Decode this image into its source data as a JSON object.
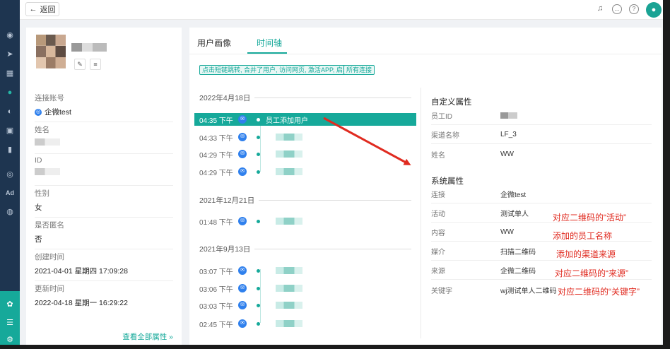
{
  "topbar": {
    "back_label": "返回"
  },
  "profile": {
    "fields": [
      {
        "label": "连接账号",
        "value": "企微test"
      },
      {
        "label": "姓名",
        "value": ""
      },
      {
        "label": "ID",
        "value": ""
      },
      {
        "label": "性别",
        "value": "女"
      },
      {
        "label": "是否匿名",
        "value": "否"
      },
      {
        "label": "创建时间",
        "value": "2021-04-01 星期四 17:09:28"
      },
      {
        "label": "更新时间",
        "value": "2022-04-18 星期一 16:29:22"
      }
    ],
    "view_all": "查看全部属性 »"
  },
  "tabs": [
    {
      "label": "用户画像"
    },
    {
      "label": "时间轴"
    }
  ],
  "filters": [
    "点击短链跳转, 合并了用户, 访问网页, 激活APP, 启动...",
    "所有连接"
  ],
  "timeline": {
    "groups": [
      {
        "date": "2022年4月18日",
        "events": [
          {
            "time": "04:35 下午",
            "text": "员工添加用户"
          },
          {
            "time": "04:33 下午",
            "text": ""
          },
          {
            "time": "04:29 下午",
            "text": ""
          },
          {
            "time": "04:29 下午",
            "text": ""
          }
        ]
      },
      {
        "date": "2021年12月21日",
        "events": [
          {
            "time": "01:48 下午",
            "text": ""
          }
        ]
      },
      {
        "date": "2021年9月13日",
        "events": [
          {
            "time": "03:07 下午",
            "text": ""
          },
          {
            "time": "03:06 下午",
            "text": ""
          },
          {
            "time": "03:03 下午",
            "text": ""
          },
          {
            "time": "02:45 下午",
            "text": ""
          }
        ]
      }
    ]
  },
  "custom_props": {
    "title": "自定义属性",
    "rows": [
      {
        "key": "员工ID",
        "value": ""
      },
      {
        "key": "渠道名称",
        "value": "LF_3"
      },
      {
        "key": "姓名",
        "value": "WW"
      }
    ]
  },
  "system_props": {
    "title": "系统属性",
    "rows": [
      {
        "key": "连接",
        "value": "企微test"
      },
      {
        "key": "活动",
        "value": "测试单人"
      },
      {
        "key": "内容",
        "value": "WW"
      },
      {
        "key": "媒介",
        "value": "扫描二维码"
      },
      {
        "key": "来源",
        "value": "企微二维码"
      },
      {
        "key": "关键字",
        "value": "wj测试单人二维码"
      }
    ]
  },
  "annotations": [
    "对应二维码的“活动”",
    "添加的员工名称",
    "添加的渠道来源",
    "对应二维码的“来源”",
    "对应二维码的“关键字”"
  ],
  "colors": {
    "accent": "#16a99a",
    "nav": "#1e3550",
    "annotation": "#e02b20",
    "message_icon": "#2f80ed"
  }
}
